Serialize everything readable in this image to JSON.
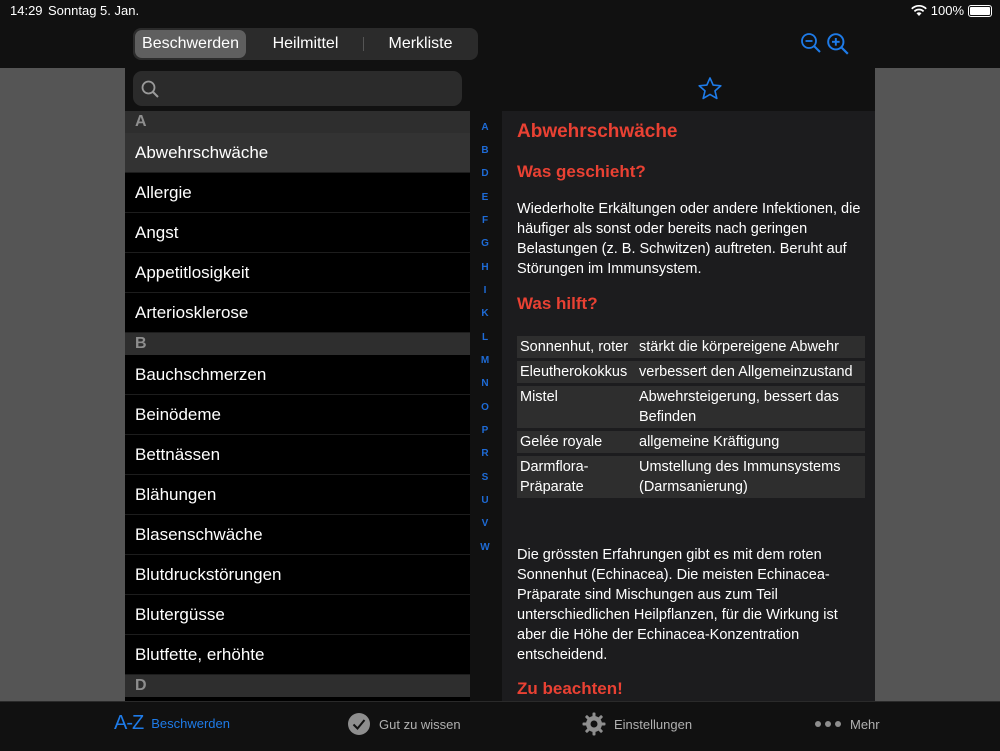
{
  "status": {
    "time": "14:29",
    "date": "Sonntag 5. Jan.",
    "battery": "100%"
  },
  "segments": [
    "Beschwerden",
    "Heilmittel",
    "Merkliste"
  ],
  "search": {
    "placeholder": ""
  },
  "list": {
    "sections": [
      {
        "letter": "A",
        "items": [
          "Abwehrschwäche",
          "Allergie",
          "Angst",
          "Appetitlosigkeit",
          "Arteriosklerose"
        ]
      },
      {
        "letter": "B",
        "items": [
          "Bauchschmerzen",
          "Beinödeme",
          "Bettnässen",
          "Blähungen",
          "Blasenschwäche",
          "Blutdruckstörungen",
          "Blutergüsse",
          "Blutfette, erhöhte"
        ]
      },
      {
        "letter": "D",
        "items": []
      }
    ],
    "selected": "Abwehrschwäche"
  },
  "index_letters": [
    "A",
    "B",
    "D",
    "E",
    "F",
    "G",
    "H",
    "I",
    "K",
    "L",
    "M",
    "N",
    "O",
    "P",
    "R",
    "S",
    "U",
    "V",
    "W"
  ],
  "detail": {
    "title": "Abwehrschwäche",
    "h1": "Was geschieht?",
    "p1": "Wiederholte Erkältungen oder andere Infektionen, die häufiger als sonst oder bereits nach geringen Belastungen (z. B. Schwitzen) auftreten. Beruht auf Störungen im Immunsystem.",
    "h2": "Was hilft?",
    "remedies": [
      {
        "name": "Sonnenhut, roter",
        "effect": "stärkt die körpereigene Abwehr"
      },
      {
        "name": "Eleutherokokkus",
        "effect": "verbessert den Allgemeinzustand"
      },
      {
        "name": "Mistel",
        "effect": "Abwehrsteigerung, bessert das Befinden"
      },
      {
        "name": "Gelée royale",
        "effect": "allgemeine Kräftigung"
      },
      {
        "name": "Darmflora-Präparate",
        "effect": "Umstellung des Immunsystems (Darmsanierung)"
      }
    ],
    "p2": "Die grössten Erfahrungen gibt es mit dem roten Sonnenhut (Echinacea). Die meisten Echinacea-Präparate sind Mischungen aus zum Teil unterschiedlichen Heilpflanzen, für die Wirkung ist aber die Höhe der Echinacea-Konzentration entscheidend.",
    "h3": "Zu beachten!"
  },
  "tabbar": {
    "az_icon_text": "A-Z",
    "tab1": "Beschwerden",
    "tab2": "Gut zu wissen",
    "tab3": "Einstellungen",
    "tab4": "Mehr"
  },
  "colors": {
    "accent": "#1e7be8",
    "heading": "#e94133"
  }
}
